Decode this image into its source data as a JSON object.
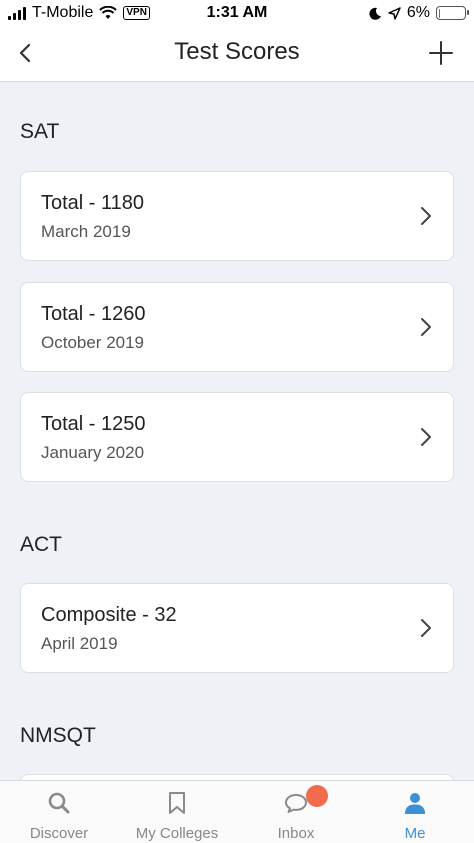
{
  "status_bar": {
    "carrier": "T-Mobile",
    "vpn": "VPN",
    "time": "1:31 AM",
    "battery": "6%",
    "battery_level": 0.06,
    "battery_color": "#e53935"
  },
  "header": {
    "title": "Test Scores",
    "back_icon": "chevron-left-icon",
    "add_icon": "plus-icon"
  },
  "sections": [
    {
      "title": "SAT",
      "items": [
        {
          "title": "Total - 1180",
          "date": "March 2019"
        },
        {
          "title": "Total - 1260",
          "date": "October 2019"
        },
        {
          "title": "Total - 1250",
          "date": "January 2020"
        }
      ]
    },
    {
      "title": "ACT",
      "items": [
        {
          "title": "Composite - 32",
          "date": "April 2019"
        }
      ]
    },
    {
      "title": "NMSQT",
      "items": []
    }
  ],
  "tab_bar": {
    "tabs": [
      {
        "label": "Discover",
        "icon": "search-icon",
        "active": false
      },
      {
        "label": "My Colleges",
        "icon": "bookmark-icon",
        "active": false
      },
      {
        "label": "Inbox",
        "icon": "chat-bubble-icon",
        "active": false,
        "badge": true
      },
      {
        "label": "Me",
        "icon": "person-icon",
        "active": true
      }
    ],
    "active_color": "#3d8fd6",
    "badge_color": "#f26b4f"
  }
}
